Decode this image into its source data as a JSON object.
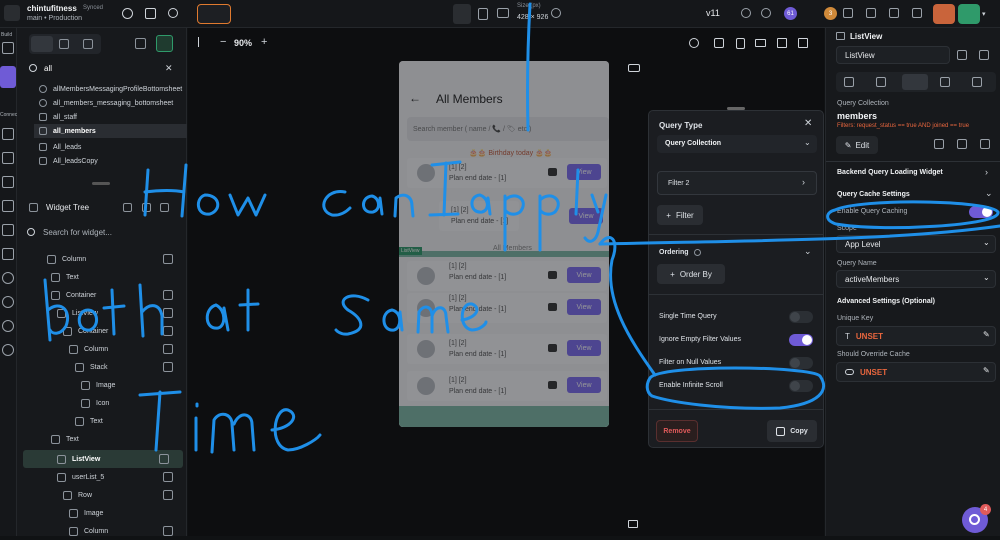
{
  "app": {
    "project_name": "chintufitness",
    "sync_status": "Synced",
    "branch": "main",
    "environment": "Production",
    "version": "v11",
    "badge_count": "61",
    "badge_count_2": "3"
  },
  "device_bar": {
    "size_label": "Size (px)",
    "size_value": "428 × 926"
  },
  "left_rail": {
    "items": [
      "Build",
      "Connect"
    ]
  },
  "search_panel": {
    "query": "all",
    "results": [
      "allMembersMessagingProfileBottomsheet",
      "all_members_messaging_bottomsheet",
      "all_staff",
      "all_members",
      "All_leads",
      "All_leadsCopy"
    ],
    "selected_index": 3
  },
  "widget_tree": {
    "title": "Widget Tree",
    "search_placeholder": "Search for widget...",
    "nodes": [
      "Column",
      "Text",
      "Container",
      "ListView",
      "Container",
      "Column",
      "Stack",
      "Image",
      "Icon",
      "Text",
      "Text",
      "ListView",
      "userList_5",
      "Row",
      "Image",
      "Column"
    ]
  },
  "canvas_toolbar": {
    "zoom": "90%"
  },
  "phone": {
    "page_title": "All Members",
    "search_placeholder": "Search member ( name / 📞 / 🏷 etc )",
    "birthday_banner": "🎂🎂 Birthday today 🎂🎂",
    "section_label": "All Members",
    "listview_tag": "ListView",
    "card_name": "[1] [2]",
    "card_sub": "Plan end date - [1]",
    "view_label": "View"
  },
  "query_panel": {
    "title": "Query Type",
    "type_value": "Query Collection",
    "filter2_label": "Filter 2",
    "add_filter_label": "Filter",
    "ordering_label": "Ordering",
    "order_by_label": "Order By",
    "single_time_label": "Single Time Query",
    "ignore_empty_label": "Ignore Empty Filter Values",
    "filter_null_label": "Filter on Null Values",
    "infinite_scroll_label": "Enable Infinite Scroll",
    "remove_label": "Remove",
    "copy_label": "Copy",
    "ignore_empty_on": true,
    "single_time_on": false,
    "filter_null_on": false,
    "infinite_scroll_on": false
  },
  "right_panel": {
    "widget_type": "ListView",
    "widget_name": "ListView",
    "query_collection_label": "Query Collection",
    "collection_name": "members",
    "filters_text": "Filters: request_status == true AND joined == true",
    "edit_label": "Edit",
    "backend_query_label": "Backend Query Loading Widget",
    "cache_settings_label": "Query Cache Settings",
    "enable_caching_label": "Enable Query Caching",
    "enable_caching_on": true,
    "scope_label": "Scope",
    "scope_value": "App Level",
    "query_name_label": "Query Name",
    "query_name_value": "activeMembers",
    "advanced_label": "Advanced Settings (Optional)",
    "unique_key_label": "Unique Key",
    "unique_key_value": "UNSET",
    "should_override_label": "Should Override Cache",
    "should_override_value": "UNSET"
  },
  "colors": {
    "accent": "#6f5bd6",
    "unset": "#e8663e",
    "annotation_blue": "#1f8fe8"
  },
  "fab": {
    "badge": "4"
  }
}
